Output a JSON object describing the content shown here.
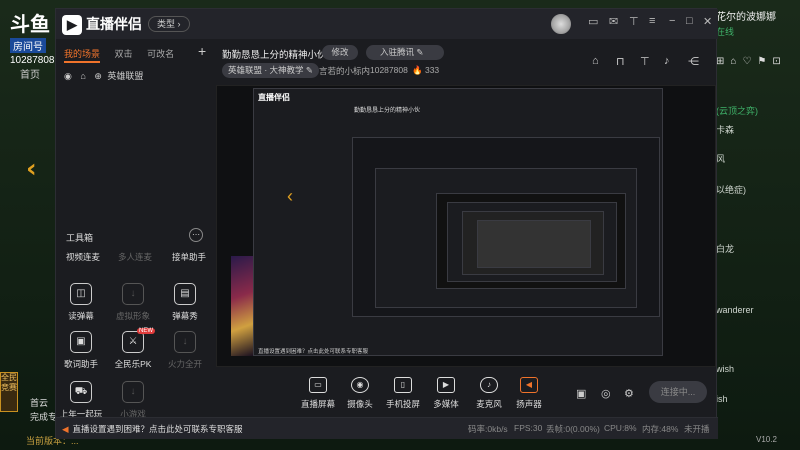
{
  "background_site": {
    "logo_text": "斗鱼",
    "room_badge": "房间号",
    "room_number": "10287808",
    "home": "首页",
    "side_badge": "全民竞赛",
    "bottom_left_label": "完成专",
    "update_notice": "当前版本：...",
    "bottom_left_extra": "首云",
    "chat_header": "花尔的波娜娜",
    "chat_header_sub": "在线",
    "chat_lines": [
      {
        "text": "(云顶之弈)",
        "color": "green"
      },
      {
        "text": "卡森",
        "color": "normal"
      },
      {
        "text": "风",
        "color": "normal"
      },
      {
        "text": "以绝症)",
        "color": "normal"
      },
      {
        "text": "白龙",
        "color": "normal"
      },
      {
        "text": "wanderer",
        "color": "normal"
      },
      {
        "text": "wish",
        "color": "normal"
      },
      {
        "text": "ish",
        "color": "normal"
      }
    ],
    "right_icons": [
      "gift-icon",
      "lock-icon",
      "heart-icon",
      "flag-icon",
      "cart-icon"
    ]
  },
  "app": {
    "brand": "直播伴侣",
    "type_pill": "类型",
    "titlebar_icons": [
      "screen-icon",
      "mail-icon",
      "shirt-icon",
      "menu-icon",
      "minimize-icon",
      "maximize-icon",
      "close-icon"
    ]
  },
  "left_panel": {
    "tabs": [
      "我的场景",
      "双击",
      "可改名"
    ],
    "active_tab": "我的场景",
    "add_symbol": "+",
    "scene": {
      "name": "英雄联盟",
      "visible_icon": "eye-icon",
      "lock_icon": "lock-icon",
      "game_icon": "gamepad-icon"
    },
    "tools_title": "工具箱",
    "tools_more_symbol": "⋯",
    "top_tools": [
      "视频连麦",
      "多人连麦",
      "接单助手"
    ],
    "tools": [
      {
        "label": "读弹幕",
        "icon": "danmaku-icon",
        "enabled": true
      },
      {
        "label": "虚拟形象",
        "icon": "download-icon",
        "enabled": false
      },
      {
        "label": "弹幕秀",
        "icon": "danmaku-show-icon",
        "enabled": true
      },
      {
        "label": "歌词助手",
        "icon": "lyrics-icon",
        "enabled": true
      },
      {
        "label": "全民乐PK",
        "icon": "pk-icon",
        "enabled": true,
        "badge": "NEW"
      },
      {
        "label": "火力全开",
        "icon": "download-icon",
        "enabled": false
      },
      {
        "label": "上年一起玩",
        "icon": "car-icon",
        "enabled": true
      },
      {
        "label": "小游戏",
        "icon": "download-icon",
        "enabled": false
      }
    ]
  },
  "room": {
    "title": "勤勤恳恳上分的精神小伙",
    "edit_label": "修改",
    "category": "入驻腾讯",
    "game": "英雄联盟 · 大神教学",
    "streamer": "言若的小标内",
    "room_id": "10287808",
    "hot": "333",
    "header_icons": [
      "home-icon",
      "unlock-icon",
      "shirt-icon",
      "bell-icon",
      "share-icon"
    ]
  },
  "toolbar": {
    "buttons": [
      {
        "label": "直播屏幕",
        "icon": "screen-share-icon"
      },
      {
        "label": "摄像头",
        "icon": "camera-icon"
      },
      {
        "label": "手机投屏",
        "icon": "phone-cast-icon"
      },
      {
        "label": "多媒体",
        "icon": "media-icon"
      },
      {
        "label": "麦克风",
        "icon": "microphone-icon"
      },
      {
        "label": "扬声器",
        "icon": "speaker-icon"
      }
    ],
    "extra_icons": [
      "record-icon",
      "preview-icon",
      "settings-icon"
    ],
    "live_button": "连接中..."
  },
  "status_bar": {
    "notice": "直播设置遇到困难？点击此处可联系专职客服",
    "bitrate": "码率:0kb/s",
    "fps": "FPS:30",
    "drop": "丢帧:0(0.00%)",
    "cpu": "CPU:8%",
    "memory": "内存:48%",
    "state": "未开播",
    "version": "V10.2"
  },
  "preview": {
    "inner_brand": "直播伴侣",
    "inner_room_title": "勤勤恳恳上分的精神小伙",
    "inner_notice": "直播设置遇到困难？点击此处可联系专职客服"
  }
}
